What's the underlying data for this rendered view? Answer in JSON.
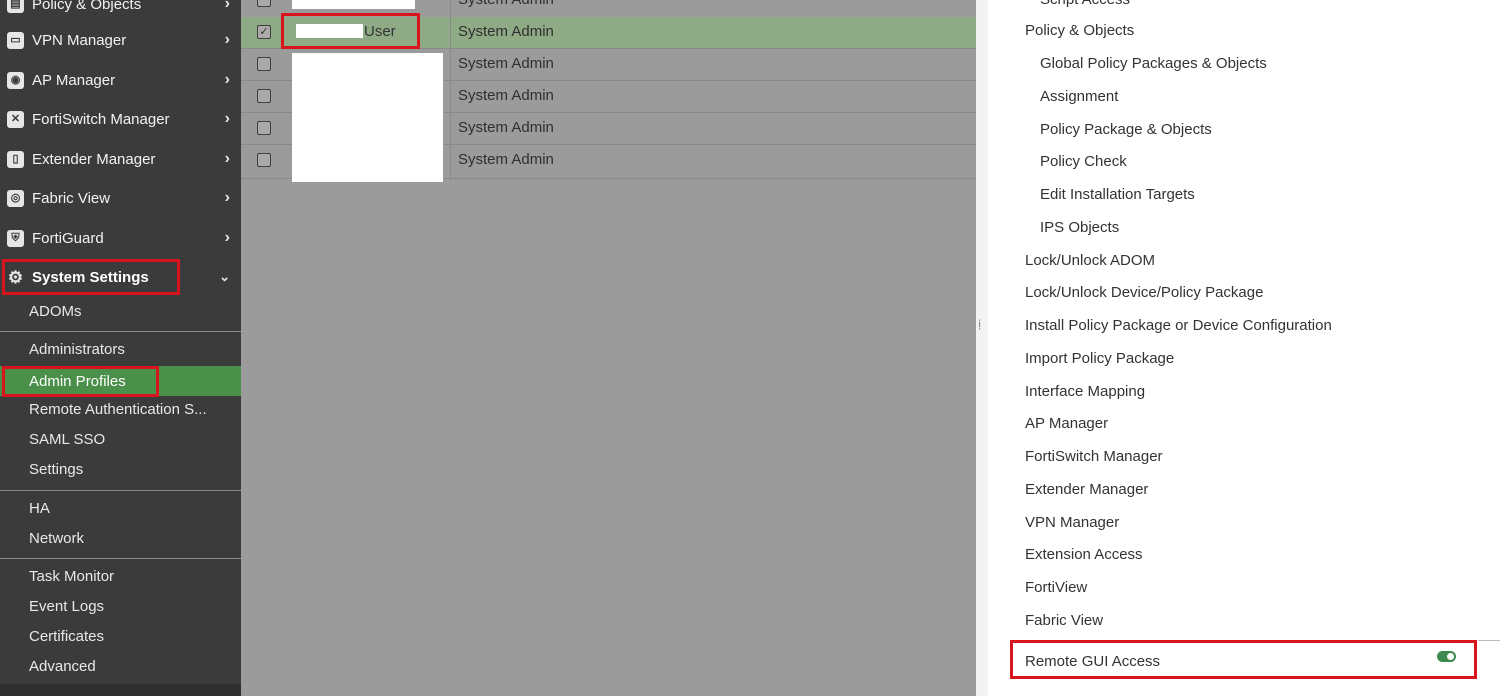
{
  "sidebar": {
    "nav": [
      {
        "label": "Policy & Objects",
        "icon": "policy-icon"
      },
      {
        "label": "VPN Manager",
        "icon": "vpn-icon"
      },
      {
        "label": "AP Manager",
        "icon": "ap-icon"
      },
      {
        "label": "FortiSwitch Manager",
        "icon": "switch-icon"
      },
      {
        "label": "Extender Manager",
        "icon": "extender-icon"
      },
      {
        "label": "Fabric View",
        "icon": "fabric-icon"
      },
      {
        "label": "FortiGuard",
        "icon": "shield-icon"
      },
      {
        "label": "System Settings",
        "icon": "gear-icon"
      }
    ],
    "sub_items": [
      {
        "label": "ADOMs"
      },
      {
        "label": "Administrators"
      },
      {
        "label": "Admin Profiles"
      },
      {
        "label": "Remote Authentication S..."
      },
      {
        "label": "SAML SSO"
      },
      {
        "label": "Settings"
      },
      {
        "label": "HA"
      },
      {
        "label": "Network"
      },
      {
        "label": "Task Monitor"
      },
      {
        "label": "Event Logs"
      },
      {
        "label": "Certificates"
      },
      {
        "label": "Advanced"
      }
    ]
  },
  "table": {
    "rows": [
      {
        "name": "",
        "role": "System Admin",
        "checked": false
      },
      {
        "name": "User",
        "role": "System Admin",
        "checked": true
      },
      {
        "name": "",
        "role": "System Admin",
        "checked": false
      },
      {
        "name": "",
        "role": "System Admin",
        "checked": false
      },
      {
        "name": "",
        "role": "System Admin",
        "checked": false
      },
      {
        "name": "",
        "role": "System Admin",
        "checked": false
      }
    ],
    "check_glyph": "✓"
  },
  "panel": {
    "permissions": [
      {
        "label": "Script Access"
      },
      {
        "label": "Policy & Objects"
      },
      {
        "label": "Global Policy Packages & Objects"
      },
      {
        "label": "Assignment"
      },
      {
        "label": "Policy Package & Objects"
      },
      {
        "label": "Policy Check"
      },
      {
        "label": "Edit Installation Targets"
      },
      {
        "label": "IPS Objects"
      },
      {
        "label": "Lock/Unlock ADOM"
      },
      {
        "label": "Lock/Unlock Device/Policy Package"
      },
      {
        "label": "Install Policy Package or Device Configuration"
      },
      {
        "label": "Import Policy Package"
      },
      {
        "label": "Interface Mapping"
      },
      {
        "label": "AP Manager"
      },
      {
        "label": "FortiSwitch Manager"
      },
      {
        "label": "Extender Manager"
      },
      {
        "label": "VPN Manager"
      },
      {
        "label": "Extension Access"
      },
      {
        "label": "FortiView"
      },
      {
        "label": "Fabric View"
      },
      {
        "label": "Remote GUI Access"
      }
    ],
    "remote_gui_access_enabled": true
  },
  "colors": {
    "active_green": "#4a8f4a",
    "selected_row": "#8eab86",
    "highlight_red": "#d9141c",
    "toggle_green": "#3d8b4c"
  }
}
